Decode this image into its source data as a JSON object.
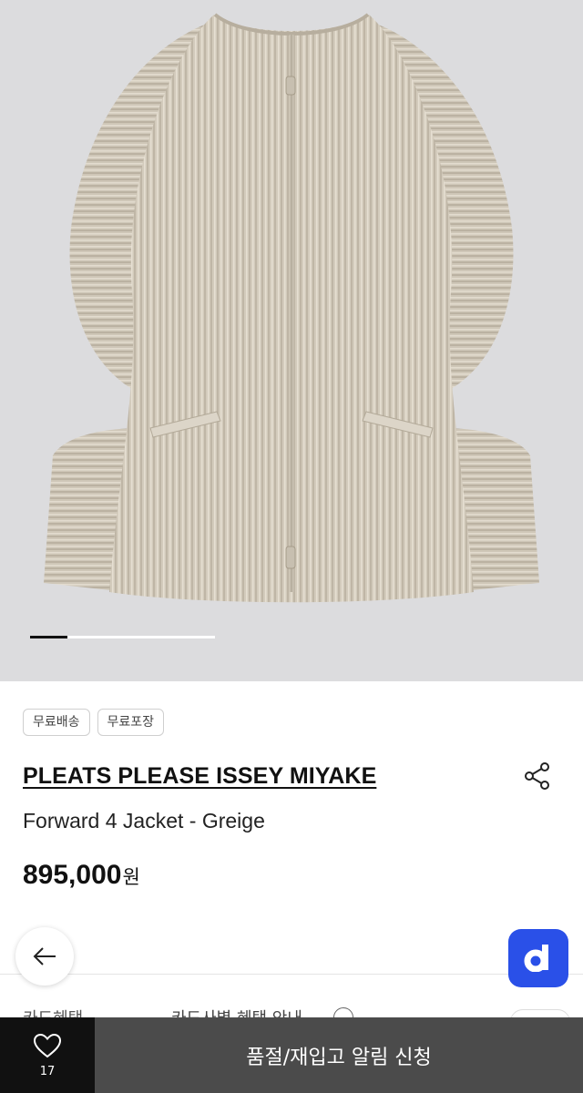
{
  "gallery": {
    "image_alt": "PLEATS PLEASE ISSEY MIYAKE Forward 4 Jacket - Greige",
    "slide_progress": 0.2
  },
  "badges": [
    "무료배송",
    "무료포장"
  ],
  "product": {
    "brand": "PLEATS PLEASE ISSEY MIYAKE",
    "name": "Forward 4 Jacket - Greige",
    "price": "895,000",
    "currency": "원"
  },
  "card_benefit": {
    "label": "카드혜택",
    "text": "카드사별 혜택 안내"
  },
  "bottom_bar": {
    "like_count": "17",
    "notify_label": "품절/재입고 알림 신청"
  },
  "icons": {
    "share": "share-icon",
    "back": "arrow-left-icon",
    "d_app": "d-logo-icon",
    "like": "heart-icon",
    "info": "info-icon"
  },
  "colors": {
    "accent_blue": "#2a50e8",
    "notify_bg": "#4b4b4b",
    "like_bg": "#111111",
    "hero_bg": "#dcdcde"
  }
}
